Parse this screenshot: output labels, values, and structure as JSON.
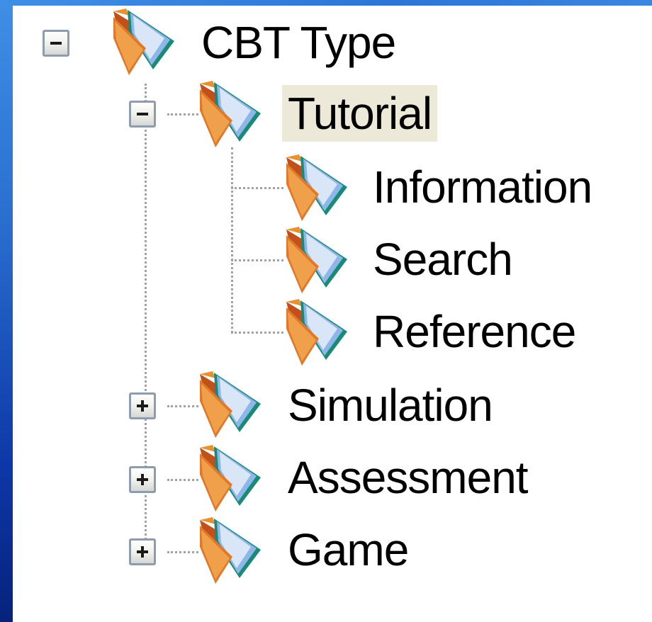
{
  "tree": {
    "root": {
      "label": "CBT Type",
      "expanded": true,
      "icon": "folder-icon",
      "children": [
        {
          "label": "Tutorial",
          "expanded": true,
          "selected": true,
          "icon": "folder-icon",
          "children": [
            {
              "label": "Information",
              "icon": "folder-icon"
            },
            {
              "label": "Search",
              "icon": "folder-icon"
            },
            {
              "label": "Reference",
              "icon": "folder-icon"
            }
          ]
        },
        {
          "label": "Simulation",
          "expanded": false,
          "icon": "folder-icon"
        },
        {
          "label": "Assessment",
          "expanded": false,
          "icon": "folder-icon"
        },
        {
          "label": "Game",
          "expanded": false,
          "icon": "folder-icon"
        }
      ]
    }
  },
  "colors": {
    "selection_background": "#ece9d8",
    "connector_dots": "#a3a3a3",
    "toggle_border": "#8f9cac",
    "folder_orange": "#d9782d",
    "slide_blue": "#2a6fd0"
  }
}
